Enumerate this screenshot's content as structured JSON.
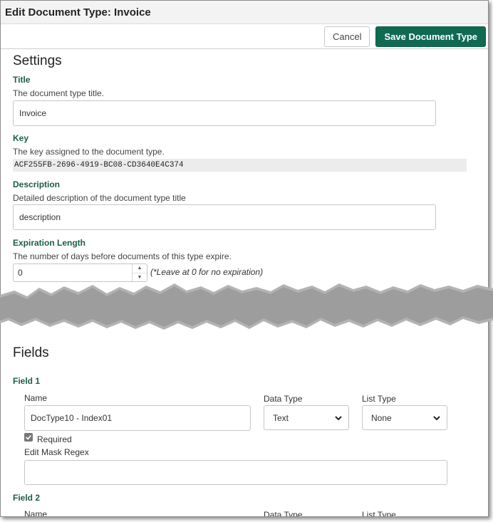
{
  "window": {
    "title": "Edit Document Type: Invoice"
  },
  "toolbar": {
    "cancel_label": "Cancel",
    "save_label": "Save Document Type"
  },
  "settings": {
    "heading": "Settings",
    "title": {
      "label": "Title",
      "help": "The document type title.",
      "value": "Invoice"
    },
    "key": {
      "label": "Key",
      "help": "The key assigned to the document type.",
      "value": "ACF255FB-2696-4919-BC08-CD3640E4C374"
    },
    "description": {
      "label": "Description",
      "help": "Detailed description of the document type title",
      "value": "description"
    },
    "expiration": {
      "label": "Expiration Length",
      "help": "The number of days before documents of this type expire.",
      "value": "0",
      "note": "(*Leave at 0 for no expiration)"
    }
  },
  "fields": {
    "heading": "Fields",
    "field1": {
      "label": "Field 1",
      "name_label": "Name",
      "name_value": "DocType10 - Index01",
      "data_type_label": "Data Type",
      "data_type_value": "Text",
      "list_type_label": "List Type",
      "list_type_value": "None",
      "required_label": "Required",
      "required_checked": true,
      "edit_mask_label": "Edit Mask Regex",
      "edit_mask_value": ""
    },
    "field2": {
      "label": "Field 2",
      "name_label": "Name",
      "data_type_label": "Data Type",
      "list_type_label": "List Type"
    }
  }
}
